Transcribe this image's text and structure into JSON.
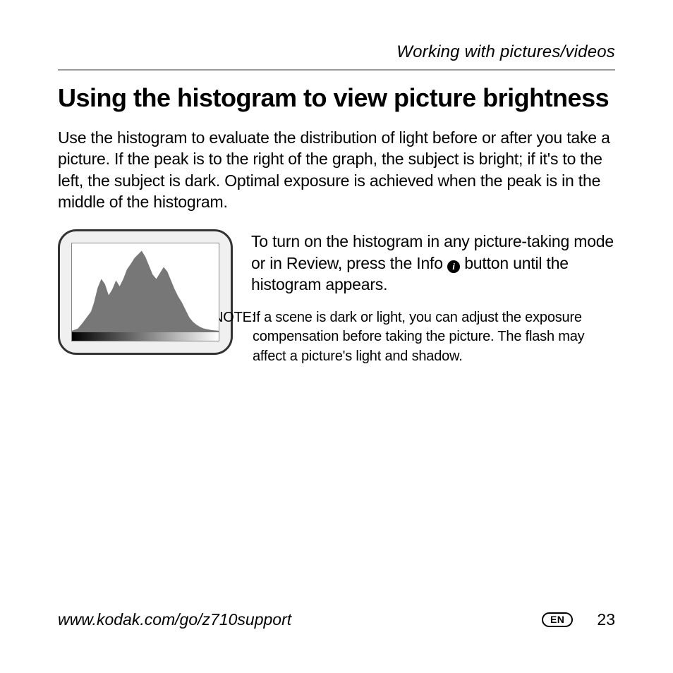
{
  "header": {
    "section": "Working with pictures/videos"
  },
  "title": "Using the histogram to view picture brightness",
  "intro": "Use the histogram to evaluate the distribution of light before or after you take a picture. If the peak is to the right of the graph, the subject is bright; if it's to the left, the subject is dark. Optimal exposure is achieved when the peak is in the middle of the histogram.",
  "instruction_pre": "To turn on the histogram in any picture-taking mode or in Review, press the Info ",
  "instruction_post": " button until the histogram appears.",
  "note": {
    "label": "NOTE:",
    "body": "If a scene is dark or light, you can adjust the exposure compensation before taking the picture. The flash may affect a picture's light and shadow."
  },
  "footer": {
    "url": "www.kodak.com/go/z710support",
    "lang": "EN",
    "page": "23"
  }
}
